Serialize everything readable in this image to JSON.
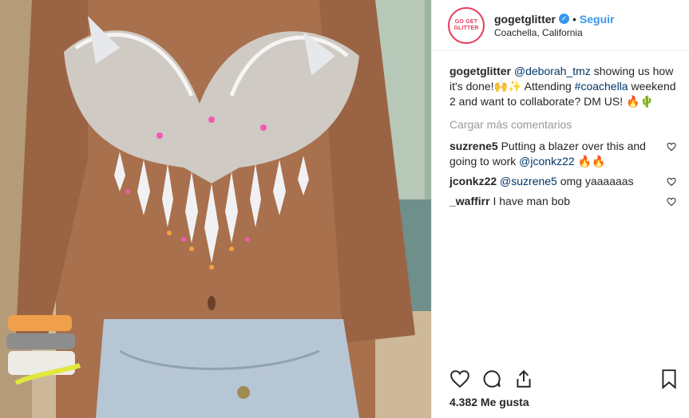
{
  "post": {
    "username": "gogetglitter",
    "follow_label": "Seguir",
    "location": "Coachella, California",
    "avatar_text": "GO GET GLITTER",
    "caption": {
      "author": "gogetglitter",
      "mention": "@deborah_tmz",
      "text1": " showing us how it's done!",
      "emoji1": "🙌✨",
      "text2": " Attending ",
      "hashtag": "#coachella",
      "text3": " weekend 2 and want to collaborate? DM US! ",
      "emoji2": "🔥🌵"
    },
    "load_more": "Cargar más comentarios",
    "comments": [
      {
        "author": "suzrene5",
        "text": "Putting a blazer over this and going to work ",
        "mention": "@jconkz22",
        "emoji": " 🔥🔥"
      },
      {
        "author": "jconkz22",
        "text": " omg yaaaaaas",
        "mention": "@suzrene5",
        "emoji": ""
      },
      {
        "author": "_waffirr",
        "text": "I have man bob",
        "mention": "",
        "emoji": ""
      }
    ],
    "likes": "4.382 Me gusta"
  },
  "colors": {
    "accent": "#3897f0",
    "link": "#003569",
    "muted": "#999999"
  },
  "icons": [
    "verified-icon",
    "heart-icon",
    "comment-icon",
    "share-icon",
    "bookmark-icon",
    "small-heart-icon"
  ]
}
